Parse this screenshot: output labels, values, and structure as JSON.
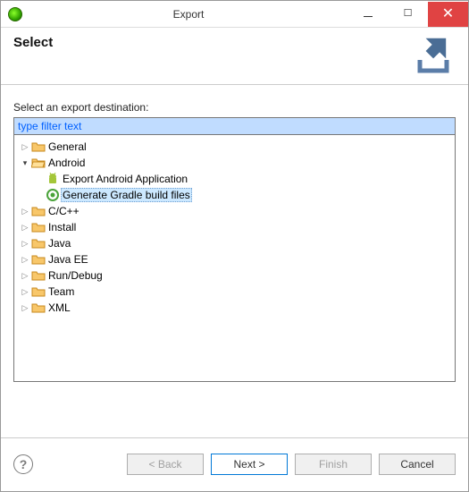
{
  "window": {
    "title": "Export"
  },
  "header": {
    "title": "Select"
  },
  "content": {
    "label": "Select an export destination:",
    "filter_placeholder": "type filter text",
    "filter_value": "type filter text",
    "tree": {
      "general": "General",
      "android": "Android",
      "android_export_app": "Export Android Application",
      "android_gradle": "Generate Gradle build files",
      "ccpp": "C/C++",
      "install": "Install",
      "java": "Java",
      "javaee": "Java EE",
      "rundebug": "Run/Debug",
      "team": "Team",
      "xml": "XML"
    }
  },
  "footer": {
    "back": "< Back",
    "next": "Next >",
    "finish": "Finish",
    "cancel": "Cancel"
  }
}
